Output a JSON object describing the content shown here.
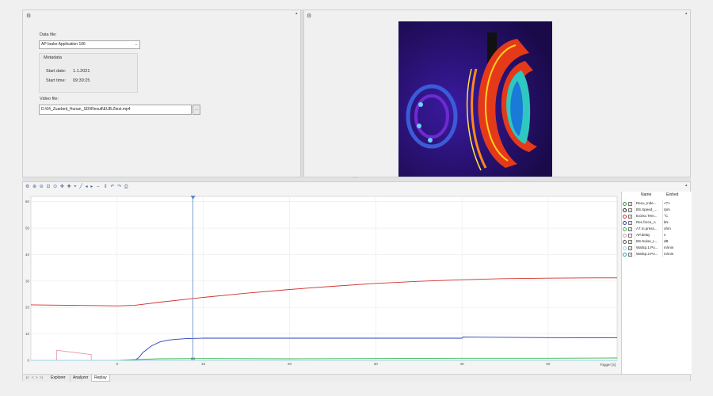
{
  "top_left": {
    "data_file_label": "Data file:",
    "data_file_value": "AP brake Application 106",
    "metadata_title": "Metadata",
    "start_date_label": "Start date:",
    "start_date_value": "1.1.2021",
    "start_time_label": "Start time:",
    "start_time_value": "09:39:25",
    "video_file_label": "Video file:",
    "video_file_value": "D:\\04_Zuarbeit_Hunan_SDI\\Result\\EUB.Ztest.mp4"
  },
  "chart_legend": {
    "col_name": "Name",
    "col_unit": "Einheit",
    "rows": [
      {
        "name": "Recu_Inde...",
        "unit": "<?>",
        "color": "#2a9b3a",
        "checked": true
      },
      {
        "name": "BS.Speed_...",
        "unit": "rpm",
        "color": "#222222",
        "checked": true
      },
      {
        "name": "B.Disc.Tem...",
        "unit": "°C",
        "color": "#d0312d",
        "checked": true
      },
      {
        "name": "Rec.force_A",
        "unit": "kN",
        "color": "#2b3fb8",
        "checked": true
      },
      {
        "name": "A7.m.press...",
        "unit": "ohm",
        "color": "#39b54a",
        "checked": true
      },
      {
        "name": "AP.delay",
        "unit": "s",
        "color": "#e89bb0",
        "checked": false
      },
      {
        "name": "BS.Noise_L...",
        "unit": "dB",
        "color": "#555555",
        "checked": true
      },
      {
        "name": "WalSp.1.Po...",
        "unit": "m/min",
        "color": "#9ad0e8",
        "checked": true
      },
      {
        "name": "WalSp.2.Po...",
        "unit": "m/min",
        "color": "#2aa9b3",
        "checked": true
      }
    ]
  },
  "tabs": [
    "Explorer",
    "Analyzer",
    "Replay"
  ],
  "nav_symbols": [
    "|<",
    "<",
    ">",
    ">|"
  ],
  "chart_data": {
    "type": "line",
    "xlabel": "Trigger [s]",
    "xlim": [
      -10,
      58
    ],
    "ylim": [
      0,
      62
    ],
    "x_ticks": [
      0,
      10,
      20,
      30,
      40,
      50
    ],
    "y_ticks": [
      0,
      10,
      20,
      30,
      40,
      50,
      60
    ],
    "x_tick_labels": [
      "0",
      "10",
      "20",
      "30",
      "40",
      "50"
    ],
    "y_tick_labels": [
      "0",
      "10",
      "20",
      "30",
      "40",
      "50",
      "60"
    ],
    "cursor_x": 8.8,
    "cursor_label": "8.8",
    "series": [
      {
        "color": "#d0312d",
        "x": [
          -10,
          -5,
          0,
          2,
          5,
          10,
          15,
          20,
          25,
          30,
          35,
          40,
          45,
          50,
          55,
          58
        ],
        "y": [
          21,
          20.8,
          20.6,
          20.8,
          22,
          23.8,
          25.4,
          26.8,
          28,
          29.1,
          29.9,
          30.5,
          30.9,
          31.1,
          31.2,
          31.2
        ]
      },
      {
        "color": "#2b3fb8",
        "x": [
          -10,
          2,
          2.5,
          3,
          4,
          5,
          6,
          7,
          8,
          10,
          20,
          30,
          40,
          40.1,
          50,
          58
        ],
        "y": [
          0,
          0,
          1,
          3,
          5.5,
          7,
          7.7,
          8,
          8.2,
          8.4,
          8.4,
          8.4,
          8.4,
          8.8,
          8.6,
          8.5
        ]
      },
      {
        "color": "#39b54a",
        "x": [
          -10,
          0,
          2,
          5,
          10,
          20,
          30,
          40,
          50,
          58
        ],
        "y": [
          0,
          0,
          0.3,
          0.6,
          0.7,
          0.6,
          0.7,
          0.8,
          0.8,
          0.9
        ]
      },
      {
        "color": "#e89bb0",
        "x": [
          -7,
          -7,
          -3,
          -3
        ],
        "y": [
          0,
          3.8,
          2.2,
          0
        ]
      },
      {
        "color": "#9ad0e8",
        "x": [
          -10,
          58
        ],
        "y": [
          0,
          0
        ]
      }
    ]
  },
  "colors": {
    "accent": "#4a6b94"
  }
}
